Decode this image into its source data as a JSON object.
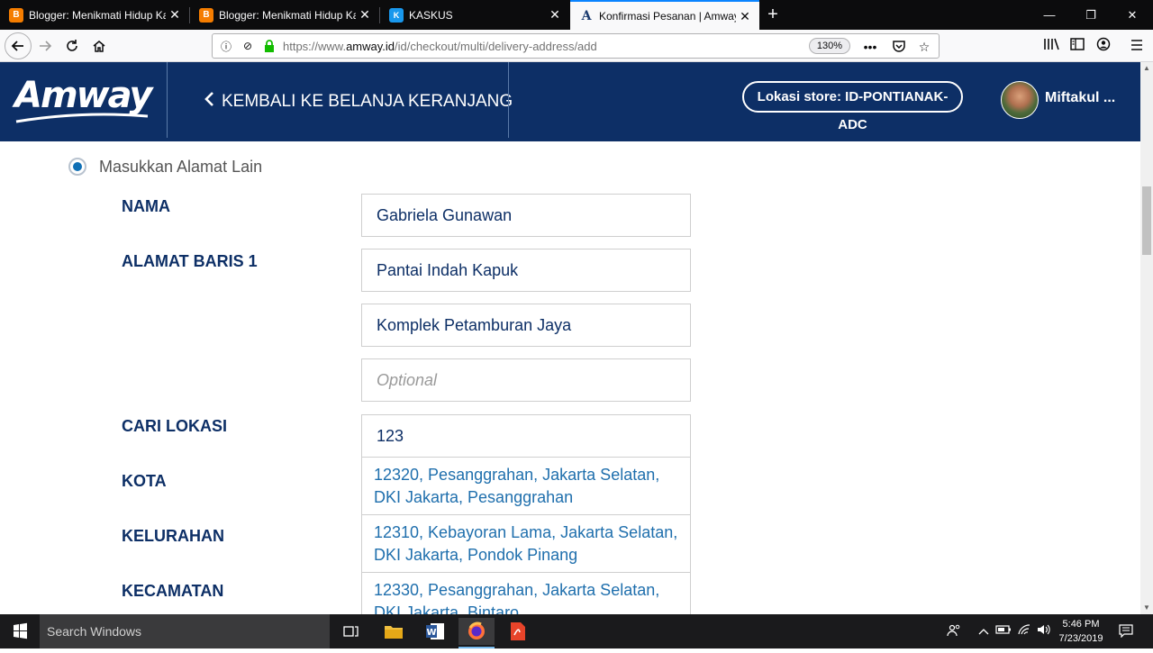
{
  "browser": {
    "tabs": [
      {
        "title": "Blogger: Menikmati Hidup Kaya",
        "favicon": "blogger-icon",
        "active": false
      },
      {
        "title": "Blogger: Menikmati Hidup Kaya",
        "favicon": "blogger-icon",
        "active": false
      },
      {
        "title": "KASKUS",
        "favicon": "kaskus-icon",
        "active": false
      },
      {
        "title": "Konfirmasi Pesanan | Amway In",
        "favicon": "amway-icon",
        "active": true
      }
    ],
    "url_prefix": "https://www.",
    "url_domain": "amway.id",
    "url_path": "/id/checkout/multi/delivery-address/add",
    "zoom": "130%",
    "accent": "#0a84ff"
  },
  "header": {
    "logo_text": "Amway",
    "back_label": "KEMBALI KE BELANJA KERANJANG",
    "store_label": "Lokasi store: ID-PONTIANAK-ADC",
    "username": "Miftakul ...",
    "bg_color": "#0d2f66"
  },
  "form": {
    "radio_label": "Masukkan Alamat Lain",
    "labels": {
      "nama": "NAMA",
      "alamat1": "ALAMAT BARIS 1",
      "cari_lokasi": "CARI LOKASI",
      "kota": "KOTA",
      "kelurahan": "KELURAHAN",
      "kecamatan": "KECAMATAN"
    },
    "nama_value": "Gabriela Gunawan",
    "alamat_line1": "Pantai Indah Kapuk",
    "alamat_line2": "Komplek Petamburan Jaya",
    "alamat_line3_placeholder": "Optional",
    "cari_lokasi_value": "123",
    "suggestions": [
      {
        "line1": "12320, Pesanggrahan, Jakarta Selatan,",
        "line2": "DKI Jakarta, Pesanggrahan"
      },
      {
        "line1": "12310, Kebayoran Lama, Jakarta Selatan,",
        "line2": "DKI Jakarta, Pondok Pinang"
      },
      {
        "line1": "12330, Pesanggrahan, Jakarta Selatan,",
        "line2": "DKI Jakarta, Bintaro"
      }
    ]
  },
  "taskbar": {
    "search_placeholder": "Search Windows",
    "time": "5:46 PM",
    "date": "7/23/2019"
  }
}
